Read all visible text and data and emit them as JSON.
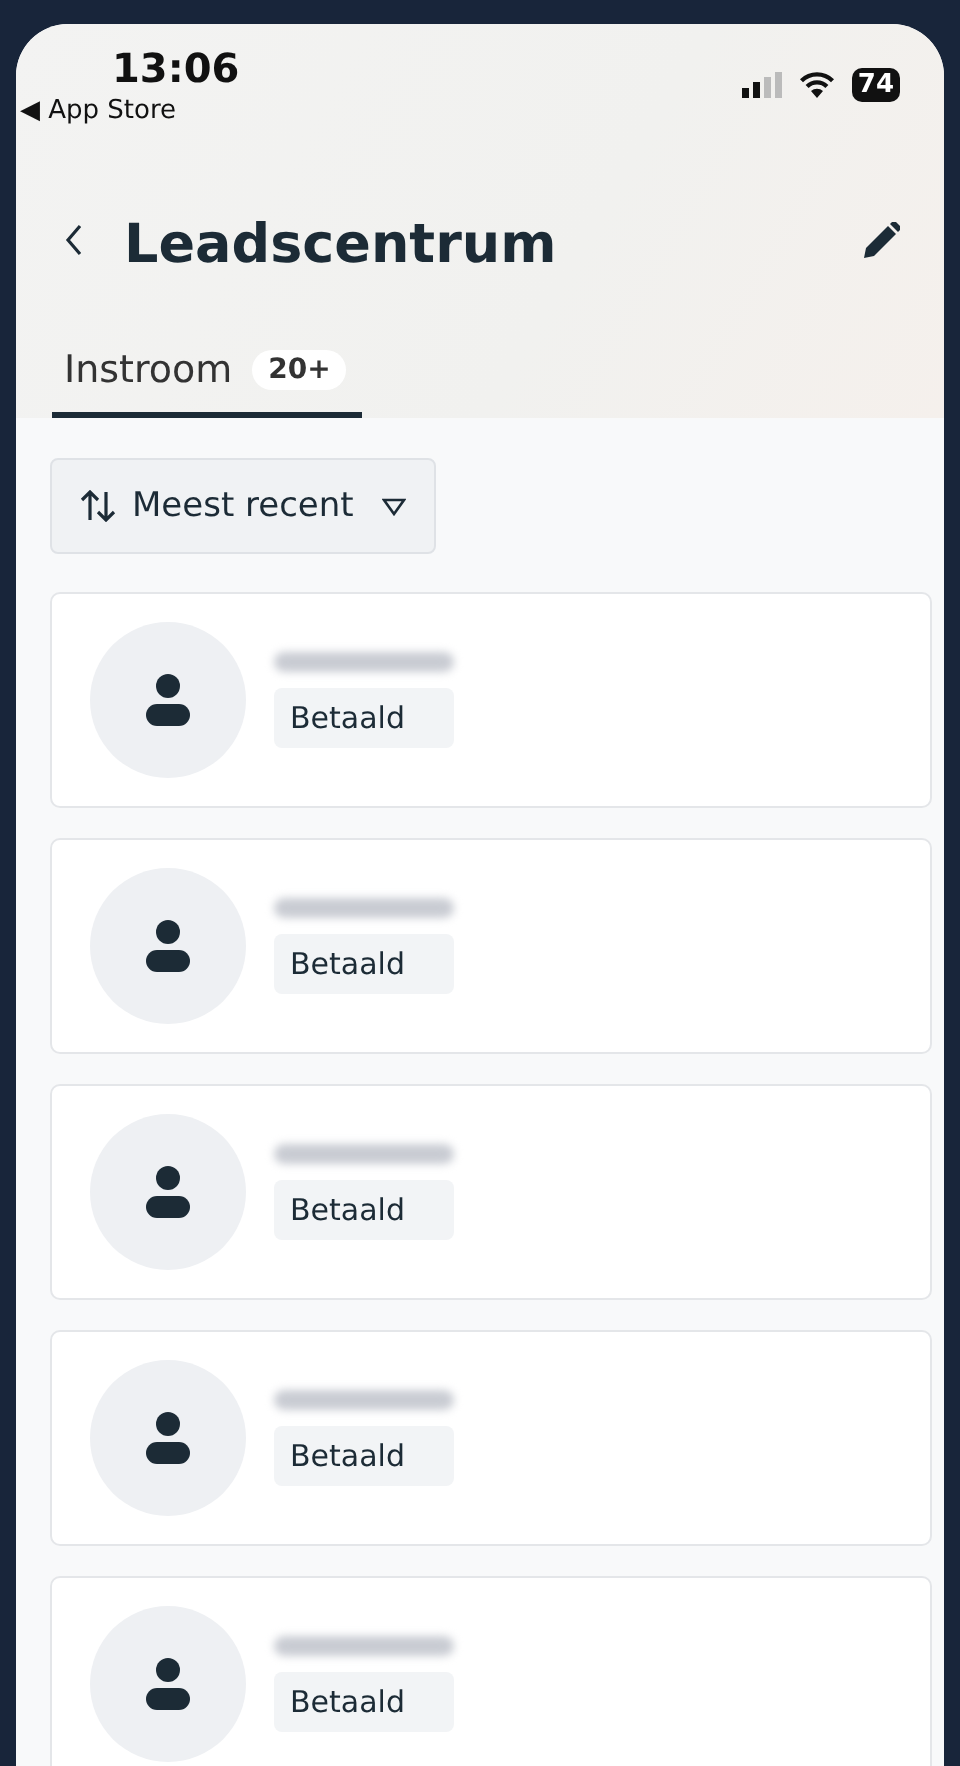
{
  "status_bar": {
    "time": "13:06",
    "back_app": "◀ App Store",
    "battery": "74"
  },
  "header": {
    "title": "Leadscentrum"
  },
  "tabs": [
    {
      "label": "Instroom",
      "count": "20+",
      "selected": true
    }
  ],
  "sort": {
    "label": "Meest recent"
  },
  "leads": [
    {
      "status": "Betaald"
    },
    {
      "status": "Betaald"
    },
    {
      "status": "Betaald"
    },
    {
      "status": "Betaald"
    },
    {
      "status": "Betaald"
    }
  ]
}
